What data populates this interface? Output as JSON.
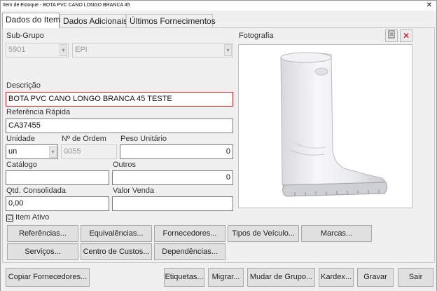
{
  "window": {
    "title": "Item de Estoque - BOTA PVC CANO LONGO BRANCA 45",
    "close_glyph": "✕"
  },
  "tabs": [
    {
      "label": "Dados do Item"
    },
    {
      "label": "Dados Adicionais"
    },
    {
      "label": "Últimos Fornecimentos"
    }
  ],
  "form": {
    "subgrupo_label": "Sub-Grupo",
    "subgrupo_code": "5901",
    "subgrupo_name": "EPI",
    "descricao_label": "Descrição",
    "descricao_value": "BOTA PVC CANO LONGO BRANCA 45 TESTE",
    "referencia_label": "Referência Rápida",
    "referencia_value": "CA37455",
    "unidade_label": "Unidade",
    "unidade_value": "un",
    "ordem_label": "Nº de Ordem",
    "ordem_value": "0055",
    "peso_label": "Peso Unitário",
    "peso_value": "0",
    "catalogo_label": "Catálogo",
    "catalogo_value": "",
    "outros_label": "Outros",
    "outros_value": "0",
    "qtd_label": "Qtd. Consolidada",
    "qtd_value": "0,00",
    "valor_label": "Valor Venda",
    "valor_value": "",
    "item_ativo_label": "Item Ativo",
    "item_ativo_checked": "☑"
  },
  "photo": {
    "label": "Fotografia"
  },
  "action_buttons": {
    "referencias": "Referências...",
    "equivalencias": "Equivalências...",
    "fornecedores": "Fornecedores...",
    "tipos_veiculo": "Tipos de Veículo...",
    "marcas": "Marcas...",
    "servicos": "Serviços...",
    "centro_custos": "Centro de Custos...",
    "dependencias": "Dependências..."
  },
  "bottom_buttons": {
    "copiar": "Copiar Fornecedores...",
    "etiquetas": "Etiquetas...",
    "migrar": "Migrar...",
    "mudar_grupo": "Mudar de Grupo...",
    "kardex": "Kardex...",
    "gravar": "Gravar",
    "sair": "Sair"
  }
}
